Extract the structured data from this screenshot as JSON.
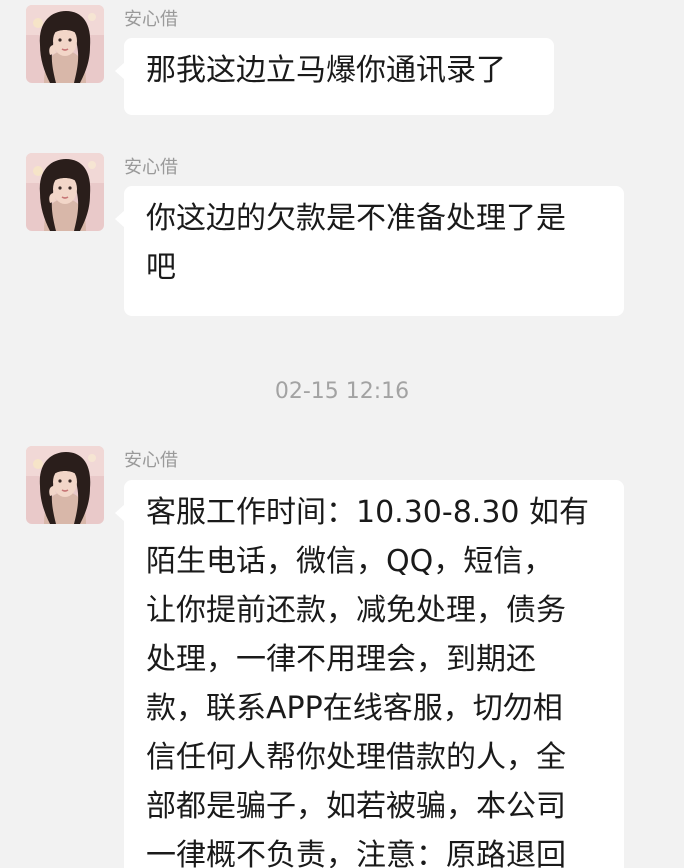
{
  "messages": [
    {
      "sender": "安心借",
      "lines": [
        "那我这边立马爆你通讯录了"
      ]
    },
    {
      "sender": "安心借",
      "lines": [
        "你这边的欠款是不准备处理了是",
        "吧"
      ]
    },
    {
      "sender": "安心借",
      "lines": [
        "客服工作时间：10.30-8.30 如有",
        "陌生电话，微信，QQ，短信，",
        "让你提前还款，减免处理，债务",
        "处理，一律不用理会，到期还",
        "款，联系APP在线客服，切勿相",
        "信任何人帮你处理借款的人，全",
        "部都是骗子，如若被骗，本公司",
        "一律概不负责，注意：原路退回"
      ]
    }
  ],
  "timestamp": "02-15 12:16",
  "colors": {
    "background": "#f2f2f2",
    "bubble": "#ffffff",
    "sender_text": "#9a9a9a",
    "timestamp_text": "#a3a3a3",
    "message_text": "#1a1a1a"
  },
  "icons": [
    "contact-avatar"
  ]
}
